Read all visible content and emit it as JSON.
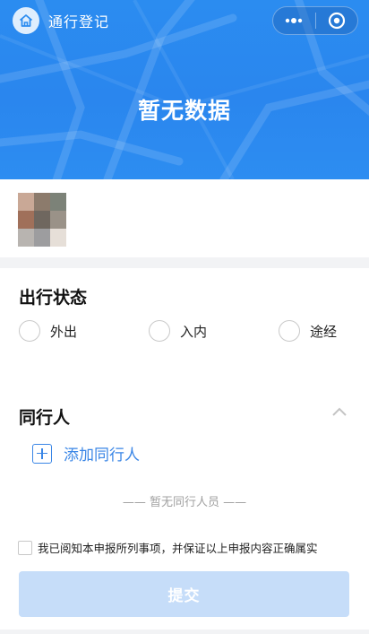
{
  "nav": {
    "title": "通行登记",
    "icons": {
      "home": "home-icon",
      "more": "more-dots-icon",
      "close": "close-circle-icon"
    }
  },
  "banner": {
    "empty_text": "暂无数据"
  },
  "travel_status": {
    "title": "出行状态",
    "options": [
      "外出",
      "入内",
      "途经"
    ]
  },
  "companions": {
    "title": "同行人",
    "add_label": "添加同行人",
    "empty_text": "—— 暂无同行人员 ——"
  },
  "agreement": {
    "text": "我已阅知本申报所列事项，并保证以上申报内容正确属实"
  },
  "submit": {
    "label": "提交"
  },
  "colors": {
    "brand_blue": "#2b8cf0",
    "link_blue": "#3a86e6",
    "submit_disabled": "#c6ddf9"
  }
}
